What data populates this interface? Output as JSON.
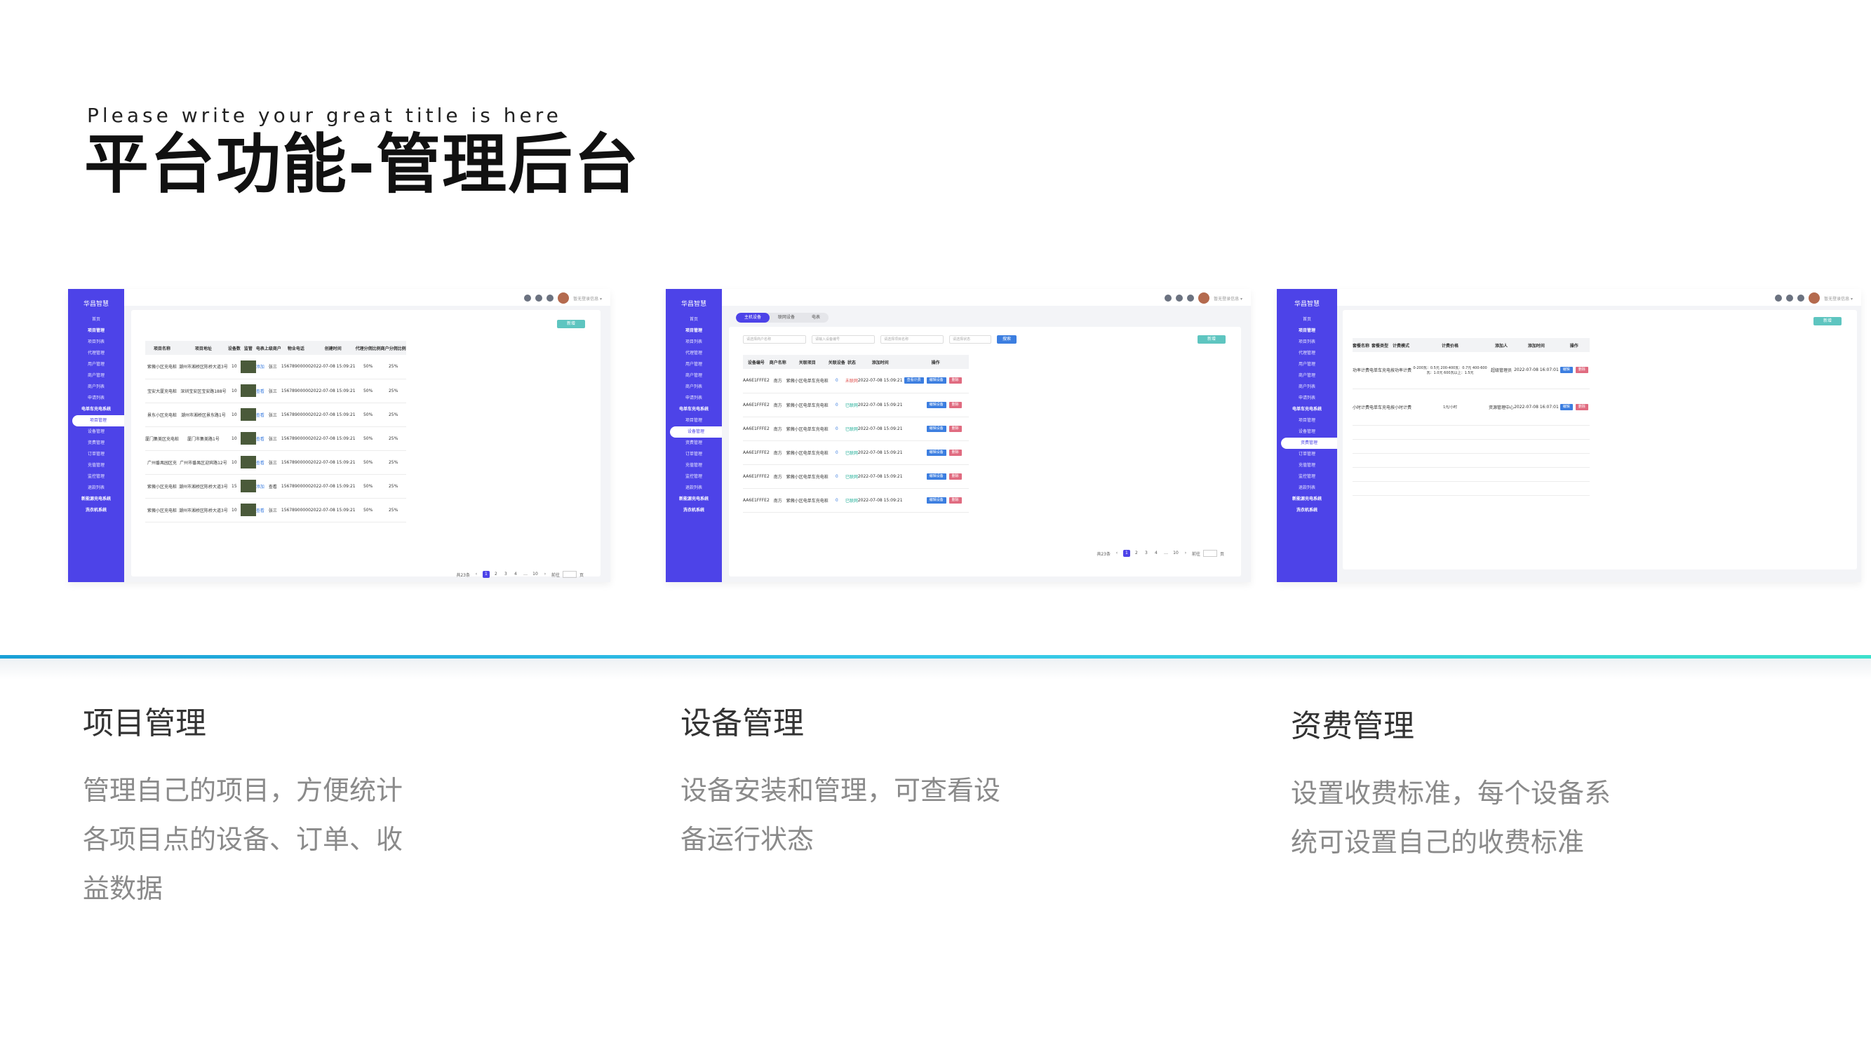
{
  "header": {
    "subtitle": "Please write your great title is here",
    "title": "平台功能-管理后台"
  },
  "app": {
    "brand": "华昌智慧",
    "user": "暂无登录信息 ▾",
    "sidebar": [
      "首页",
      "项目管理",
      "项目列表",
      "代理管理",
      "用户管理",
      "商户管理",
      "商户列表",
      "申请列表",
      "电单车充电系统",
      "项目管理",
      "设备管理",
      "资费管理",
      "订单管理",
      "充值管理",
      "监控管理",
      "退款列表",
      "新能源充电系统",
      "洗衣机系统"
    ]
  },
  "screen1": {
    "add": "新增",
    "headers": [
      "项目名称",
      "项目地址",
      "设备数",
      "监管",
      "电表",
      "上级商户",
      "物业电话",
      "创建时间",
      "代理分佣比例",
      "商户分佣比例"
    ],
    "rows": [
      [
        "紫薇小区充电桩",
        "潮州市湘桥区陈桥大道3号",
        "10",
        "",
        "添加",
        "张三",
        "15678900000",
        "2022-07-08 15:09:21",
        "50%",
        "25%"
      ],
      [
        "宝安大厦充电桩",
        "深圳宝安区宝安路188号",
        "10",
        "",
        "查看",
        "张三",
        "15678900000",
        "2022-07-08 15:09:21",
        "50%",
        "25%"
      ],
      [
        "景东小区充电桩",
        "潮州市湘桥区景东路1号",
        "10",
        "",
        "查看",
        "张三",
        "15678900000",
        "2022-07-08 15:09:21",
        "50%",
        "25%"
      ],
      [
        "厦门集美区充电桩",
        "厦门市集美路1号",
        "10",
        "",
        "查看",
        "张三",
        "15678900000",
        "2022-07-08 15:09:21",
        "50%",
        "25%"
      ],
      [
        "广州番禺园区充",
        "广州市番禺区迎宾路12号",
        "10",
        "",
        "查看",
        "张三",
        "15678900000",
        "2022-07-08 15:09:21",
        "50%",
        "25%"
      ],
      [
        "紫薇小区充电桩",
        "潮州市湘桥区陈桥大道3号",
        "15",
        "",
        "添加",
        "查看",
        "15678900000",
        "2022-07-08 15:09:21",
        "50%",
        "25%"
      ],
      [
        "紫薇小区充电桩",
        "潮州市湘桥区陈桥大道3号",
        "10",
        "",
        "查看",
        "张三",
        "15678900000",
        "2022-07-08 15:09:21",
        "50%",
        "25%"
      ]
    ],
    "pager": {
      "total": "共23条",
      "pages": [
        "1",
        "2",
        "3",
        "4",
        "…",
        "10"
      ],
      "goto": "前往",
      "page": "页"
    }
  },
  "screen2": {
    "tabs": [
      "主机设备",
      "联网设备",
      "电表"
    ],
    "filters": [
      "请选择商户名称",
      "请输入设备编号",
      "请选择项目名称",
      "请选择状态"
    ],
    "search": "搜索",
    "add": "新增",
    "headers": [
      "设备编号",
      "商户名称",
      "关联项目",
      "关联设备",
      "状态",
      "添加时间",
      "操作"
    ],
    "rows": [
      [
        "AA6E1FFFE2",
        "南方",
        "紫薇小区电单车充电桩",
        "0",
        "未联网",
        "2022-07-08 15:09:21"
      ],
      [
        "AA6E1FFFE2",
        "南方",
        "紫薇小区电单车充电桩",
        "0",
        "已联网",
        "2022-07-08 15:09:21"
      ],
      [
        "AA6E1FFFE2",
        "南方",
        "紫薇小区电单车充电桩",
        "0",
        "已联网",
        "2022-07-08 15:09:21"
      ],
      [
        "AA6E1FFFE2",
        "南方",
        "紫薇小区电单车充电桩",
        "0",
        "已联网",
        "2022-07-08 15:09:21"
      ],
      [
        "AA6E1FFFE2",
        "南方",
        "紫薇小区电单车充电桩",
        "0",
        "已联网",
        "2022-07-08 15:09:21"
      ],
      [
        "AA6E1FFFE2",
        "南方",
        "紫薇小区电单车充电桩",
        "0",
        "已联网",
        "2022-07-08 15:09:21"
      ]
    ],
    "actions": {
      "extra": "查看计费",
      "edit": "编辑设备",
      "del": "删除"
    },
    "pager": {
      "total": "共23条",
      "pages": [
        "1",
        "2",
        "3",
        "4",
        "…",
        "10"
      ],
      "goto": "前往",
      "page": "页"
    }
  },
  "screen3": {
    "add": "新增",
    "headers": [
      "套餐名称",
      "套餐类型",
      "计费模式",
      "计费价格",
      "添加人",
      "添加时间",
      "操作"
    ],
    "rows": [
      [
        "功率计费",
        "电单车充电",
        "按功率计费",
        "0-200瓦：0.5元 200-400瓦：0.7元 400-600瓦：1.0元 600瓦以上：1.5元",
        "超级管理员",
        "2022-07-08 16:07:01"
      ],
      [
        "小时计费",
        "电单车充电",
        "按小时计费",
        "1元/小时",
        "资源管理中心",
        "2022-07-08 16:07:01"
      ]
    ],
    "actions": {
      "edit": "编辑",
      "del": "删除"
    }
  },
  "features": [
    {
      "title": "项目管理",
      "desc": [
        "管理自己的项目，方便统计",
        "各项目点的设备、订单、收",
        "益数据"
      ]
    },
    {
      "title": "设备管理",
      "desc": [
        "设备安装和管理，可查看设",
        "备运行状态"
      ]
    },
    {
      "title": "资费管理",
      "desc": [
        "设置收费标准，每个设备系",
        "统可设置自己的收费标准"
      ]
    }
  ]
}
